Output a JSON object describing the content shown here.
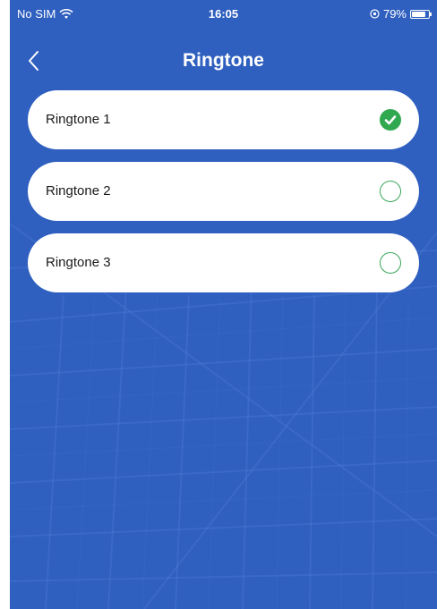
{
  "status_bar": {
    "carrier": "No SIM",
    "time": "16:05",
    "battery": "79%"
  },
  "header": {
    "title": "Ringtone"
  },
  "ringtones": [
    {
      "label": "Ringtone 1",
      "selected": true
    },
    {
      "label": "Ringtone 2",
      "selected": false
    },
    {
      "label": "Ringtone 3",
      "selected": false
    }
  ],
  "colors": {
    "background": "#2f5fbf",
    "check_green": "#2fa84f"
  }
}
